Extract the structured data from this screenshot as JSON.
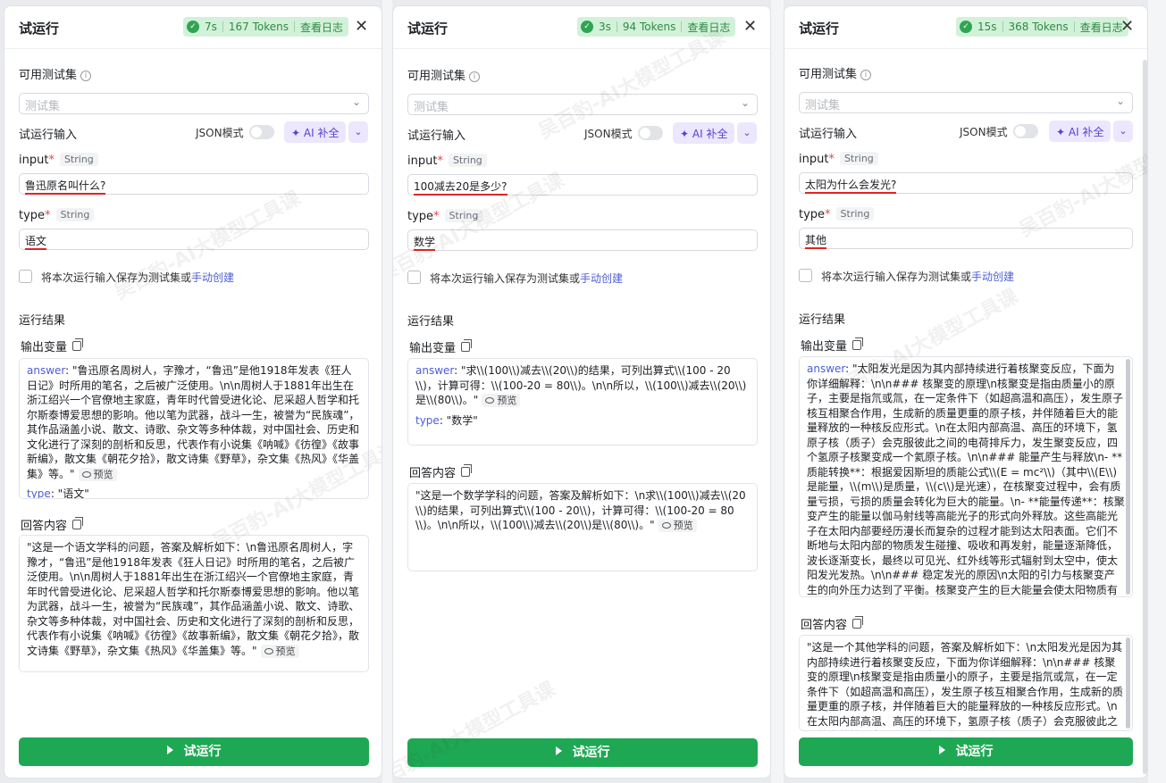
{
  "panels": [
    {
      "title": "试运行",
      "badge": {
        "time": "7s",
        "tokens": "167 Tokens",
        "log": "查看日志"
      },
      "testset_label": "可用测试集",
      "testset_placeholder": "测试集",
      "input_label": "试运行输入",
      "json_label": "JSON模式",
      "ai_label": "AI 补全",
      "fields": [
        {
          "name": "input",
          "type": "String",
          "value": "鲁迅原名叫什么?"
        },
        {
          "name": "type",
          "type": "String",
          "value": "语文"
        }
      ],
      "save_text": "将本次运行输入保存为测试集或",
      "save_link": "手动创建",
      "result_label": "运行结果",
      "output_label": "输出变量",
      "output_answer_key": "answer",
      "output_answer": "\"鲁迅原名周树人，字豫才，“鲁迅”是他1918年发表《狂人日记》时所用的笔名，之后被广泛使用。\\n\\n周树人于1881年出生在浙江绍兴一个官僚地主家庭，青年时代曾受进化论、尼采超人哲学和托尔斯泰博爱思想的影响。他以笔为武器，战斗一生，被誉为“民族魂”，其作品涵盖小说、散文、诗歌、杂文等多种体裁，对中国社会、历史和文化进行了深刻的剖析和反思，代表作有小说集《呐喊》《彷徨》《故事新编》，散文集《朝花夕拾》，散文诗集《野草》，杂文集《热风》《华盖集》等。\"",
      "output_type_key": "type",
      "output_type": "\"语文\"",
      "reply_label": "回答内容",
      "reply_text": "\"这是一个语文学科的问题，答案及解析如下：\\n鲁迅原名周树人，字豫才，“鲁迅”是他1918年发表《狂人日记》时所用的笔名，之后被广泛使用。\\n\\n周树人于1881年出生在浙江绍兴一个官僚地主家庭，青年时代曾受进化论、尼采超人哲学和托尔斯泰博爱思想的影响。他以笔为武器，战斗一生，被誉为“民族魂”，其作品涵盖小说、散文、诗歌、杂文等多种体裁，对中国社会、历史和文化进行了深刻的剖析和反思，代表作有小说集《呐喊》《彷徨》《故事新编》，散文集《朝花夕拾》，散文诗集《野草》，杂文集《热风》《华盖集》等。\"",
      "preview_label": "预览",
      "run_label": "试运行"
    },
    {
      "title": "试运行",
      "badge": {
        "time": "3s",
        "tokens": "94 Tokens",
        "log": "查看日志"
      },
      "testset_label": "可用测试集",
      "testset_placeholder": "测试集",
      "input_label": "试运行输入",
      "json_label": "JSON模式",
      "ai_label": "AI 补全",
      "fields": [
        {
          "name": "input",
          "type": "String",
          "value": "100减去20是多少?"
        },
        {
          "name": "type",
          "type": "String",
          "value": "数学"
        }
      ],
      "save_text": "将本次运行输入保存为测试集或",
      "save_link": "手动创建",
      "result_label": "运行结果",
      "output_label": "输出变量",
      "output_answer_key": "answer",
      "output_answer": "\"求\\\\(100\\\\)减去\\\\(20\\\\)的结果，可列出算式\\\\(100 - 20\\\\)，计算可得：\\\\(100-20 = 80\\\\)。\\n\\n所以，\\\\(100\\\\)减去\\\\(20\\\\)是\\\\(80\\\\)。\"",
      "output_type_key": "type",
      "output_type": "\"数学\"",
      "reply_label": "回答内容",
      "reply_text": "\"这是一个数学学科的问题，答案及解析如下：\\n求\\\\(100\\\\)减去\\\\(20\\\\)的结果，可列出算式\\\\(100 - 20\\\\)，计算可得：\\\\(100-20 = 80\\\\)。\\n\\n所以，\\\\(100\\\\)减去\\\\(20\\\\)是\\\\(80\\\\)。\"",
      "preview_label": "预览",
      "run_label": "试运行"
    },
    {
      "title": "试运行",
      "badge": {
        "time": "15s",
        "tokens": "368 Tokens",
        "log": "查看日志"
      },
      "testset_label": "可用测试集",
      "testset_placeholder": "测试集",
      "input_label": "试运行输入",
      "json_label": "JSON模式",
      "ai_label": "AI 补全",
      "fields": [
        {
          "name": "input",
          "type": "String",
          "value": "太阳为什么会发光?"
        },
        {
          "name": "type",
          "type": "String",
          "value": "其他"
        }
      ],
      "save_text": "将本次运行输入保存为测试集或",
      "save_link": "手动创建",
      "result_label": "运行结果",
      "output_label": "输出变量",
      "output_answer_key": "answer",
      "output_answer": "\"太阳发光是因为其内部持续进行着核聚变反应，下面为你详细解释：\\n\\n### 核聚变的原理\\n核聚变是指由质量小的原子，主要是指氘或氚，在一定条件下（如超高温和高压），发生原子核互相聚合作用，生成新的质量更重的原子核，并伴随着巨大的能量释放的一种核反应形式。\\n在太阳内部高温、高压的环境下，氢原子核（质子）会克服彼此之间的电荷排斥力，发生聚变反应，四个氢原子核聚变成一个氦原子核。\\n\\n### 能量产生与释放\\n- **质能转换**：根据爱因斯坦的质能公式\\\\(E = mc²\\\\)（其中\\\\(E\\\\)是能量，\\\\(m\\\\)是质量，\\\\(c\\\\)是光速），在核聚变过程中，会有质量亏损，亏损的质量会转化为巨大的能量。\\n- **能量传递**：核聚变产生的能量以伽马射线等高能光子的形式向外释放。这些高能光子在太阳内部要经历漫长而复杂的过程才能到达太阳表面。它们不断地与太阳内部的物质发生碰撞、吸收和再发射，能量逐渐降低，波长逐渐变长，最终以可见光、红外线等形式辐射到太空中，使太阳发光发热。\\n\\n### 稳定发光的原因\\n太阳的引力与核聚变产生的向外压力达到了平衡。核聚变产生的巨大能量会使太阳物质有向外膨胀的趋势，而太阳自身的引力则试图将物质向内拉，这两种力量",
      "reply_label": "回答内容",
      "reply_text": "\"这是一个其他学科的问题，答案及解析如下：\\n太阳发光是因为其内部持续进行着核聚变反应，下面为你详细解释：\\n\\n### 核聚变的原理\\n核聚变是指由质量小的原子，主要是指氘或氚，在一定条件下（如超高温和高压），发生原子核互相聚合作用，生成新的质量更重的原子核，并伴随着巨大的能量释放的一种核反应形式。\\n在太阳内部高温、高压的环境下，氢原子核（质子）会克服彼此之间的电荷排斥力，发生聚变反应，四个氢原子",
      "preview_label": "预览",
      "run_label": "试运行"
    }
  ],
  "watermark": "吴百豹-AI大模型工具课",
  "colors": {
    "run_green": "#1ea853",
    "badge_bg": "#d2f1d9",
    "ai_purple": "#5a3fd4",
    "link": "#4c5fd5",
    "underline": "#e02424"
  },
  "icons": [
    "check-circle-icon",
    "close-icon",
    "info-icon",
    "chevron-down-icon",
    "sparkle-icon",
    "copy-icon",
    "eye-icon",
    "play-icon"
  ]
}
